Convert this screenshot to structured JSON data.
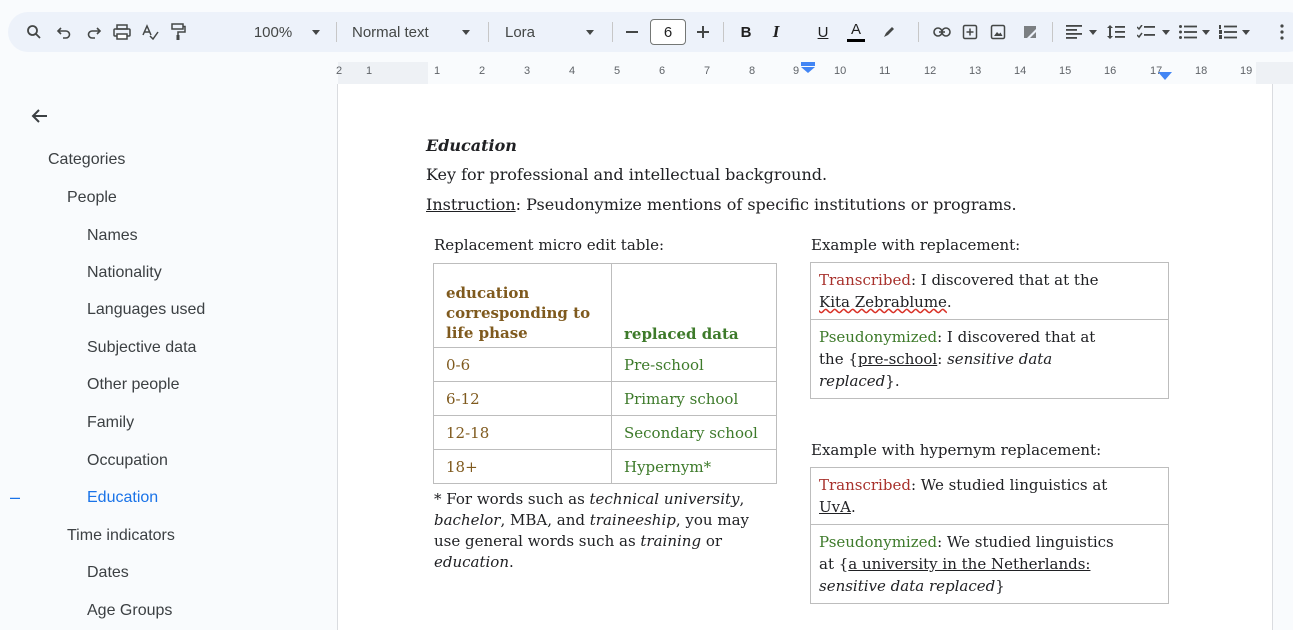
{
  "toolbar": {
    "zoom": "100%",
    "style": "Normal text",
    "font": "Lora",
    "font_size": "6",
    "bold": "B",
    "italic": "I",
    "underline": "U",
    "text_color": "A",
    "checklist_glyph": "✓☰",
    "bullets_glyph": "☰"
  },
  "ruler": [
    "2",
    "1",
    "1",
    "2",
    "3",
    "4",
    "5",
    "6",
    "7",
    "8",
    "9",
    "10",
    "11",
    "12",
    "13",
    "14",
    "15",
    "16",
    "17",
    "18",
    "19"
  ],
  "sidebar": {
    "back_icon": "arrow-left-icon",
    "items": [
      {
        "label": "Categories"
      },
      {
        "label": "People"
      },
      {
        "label": "Names"
      },
      {
        "label": "Nationality"
      },
      {
        "label": "Languages used"
      },
      {
        "label": "Subjective data"
      },
      {
        "label": "Other people"
      },
      {
        "label": "Family"
      },
      {
        "label": "Occupation"
      },
      {
        "label": "Education"
      },
      {
        "label": "Time indicators"
      },
      {
        "label": "Dates"
      },
      {
        "label": "Age Groups"
      }
    ],
    "active_marker": "–"
  },
  "doc": {
    "heading": "Education",
    "line1": "Key for professional and intellectual background.",
    "instruction_label": "Instruction",
    "instruction_text": ": Pseudonymize mentions of specific institutions or programs.",
    "table_caption": "Replacement micro edit table:",
    "table": {
      "header_1": [
        "education",
        "corresponding to",
        "life phase"
      ],
      "header_2": "replaced data",
      "rows": [
        [
          "0-6",
          "Pre-school"
        ],
        [
          "6-12",
          "Primary school"
        ],
        [
          "12-18",
          "Secondary school"
        ],
        [
          "18+",
          "Hypernym*"
        ]
      ]
    },
    "footnote": {
      "l1a": "* For words such as ",
      "l1b": "technical university",
      "l1c": ",",
      "l2a": "bachelor",
      "l2b": ", MBA, and ",
      "l2c": "traineeship",
      "l2d": ", you may",
      "l3a": "use general words such as ",
      "l3b": "training",
      "l3c": " or",
      "l4a": "education",
      "l4b": "."
    },
    "example1": {
      "caption": "Example with replacement:",
      "t_label": "Transcribed",
      "t_text": ": I discovered that at the",
      "t_name": "Kita Zebrablume",
      "t_end": ".",
      "p_label": "Pseudonymized",
      "p_text": ": I discovered that at",
      "p_the": "the {",
      "p_repl": "pre-school",
      "p_colon": ": ",
      "p_sens1": "sensitive data",
      "p_sens2": "replaced",
      "p_end": "}."
    },
    "example2": {
      "caption": "Example with hypernym replacement:",
      "t_label": "Transcribed",
      "t_text": ": We studied linguistics at",
      "t_name": "UvA",
      "t_end": ".",
      "p_label": "Pseudonymized",
      "p_text": ": We studied linguistics",
      "p_at": "at {",
      "p_repl": "a university in the Netherlands:",
      "p_sens": "sensitive data replaced",
      "p_end": "}"
    }
  }
}
